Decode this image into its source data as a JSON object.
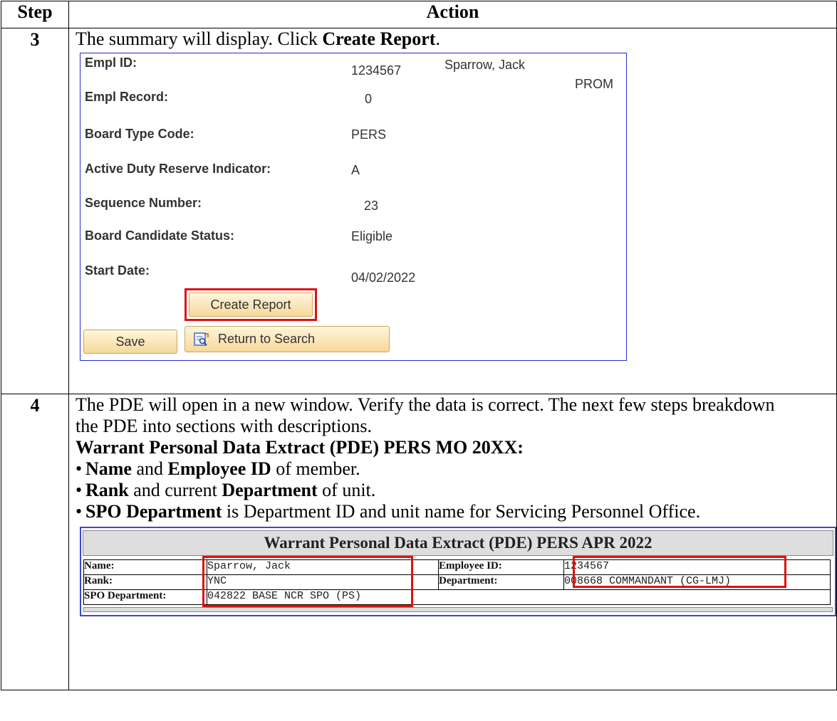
{
  "table": {
    "header_step": "Step",
    "header_action": "Action"
  },
  "step3": {
    "number": "3",
    "text_pre": "The summary will display. Click ",
    "text_bold": "Create Report",
    "text_post": ".",
    "panel": {
      "empl_id_label": "Empl ID:",
      "empl_id_value": "1234567",
      "name_value": "Sparrow, Jack",
      "prom_value": "PROM",
      "empl_record_label": "Empl Record:",
      "empl_record_value": "0",
      "board_type_label": "Board Type Code:",
      "board_type_value": "PERS",
      "adri_label": "Active Duty Reserve Indicator:",
      "adri_value": "A",
      "sequence_label": "Sequence Number:",
      "sequence_value": "23",
      "candidate_status_label": "Board Candidate Status:",
      "candidate_status_value": "Eligible",
      "start_date_label": "Start Date:",
      "start_date_value": "04/02/2022",
      "create_report_button": "Create Report",
      "save_button": "Save",
      "return_button": "Return to Search"
    }
  },
  "step4": {
    "number": "4",
    "para": "The PDE will open in a new window. Verify the data is correct. The next few steps breakdown the PDE into sections with descriptions.",
    "heading": "Warrant Personal Data Extract (PDE) PERS MO 20XX:",
    "bullets": [
      {
        "b1": "Name",
        "t1": " and ",
        "b2": "Employee ID",
        "t2": " of member."
      },
      {
        "b1": "Rank",
        "t1": " and current ",
        "b2": "Department",
        "t2": " of unit."
      },
      {
        "b1": "SPO Department",
        "t1": " is Department ID and unit name for Servicing Personnel Office.",
        "b2": "",
        "t2": ""
      }
    ],
    "pde": {
      "title": "Warrant Personal Data Extract (PDE)  PERS APR 2022",
      "name_label": "Name:",
      "name_value": "Sparrow, Jack",
      "emplid_label": "Employee ID:",
      "emplid_value": "1234567",
      "rank_label": "Rank:",
      "rank_value": "YNC",
      "dept_label": "Department:",
      "dept_value": "008668 COMMANDANT (CG-LMJ)",
      "spo_label": "SPO Department:",
      "spo_value": "042822 BASE NCR SPO (PS)"
    }
  },
  "colors": {
    "highlight": "#e01010",
    "panel_border": "#2a2ad0",
    "button_fill": "#f7d89a"
  }
}
